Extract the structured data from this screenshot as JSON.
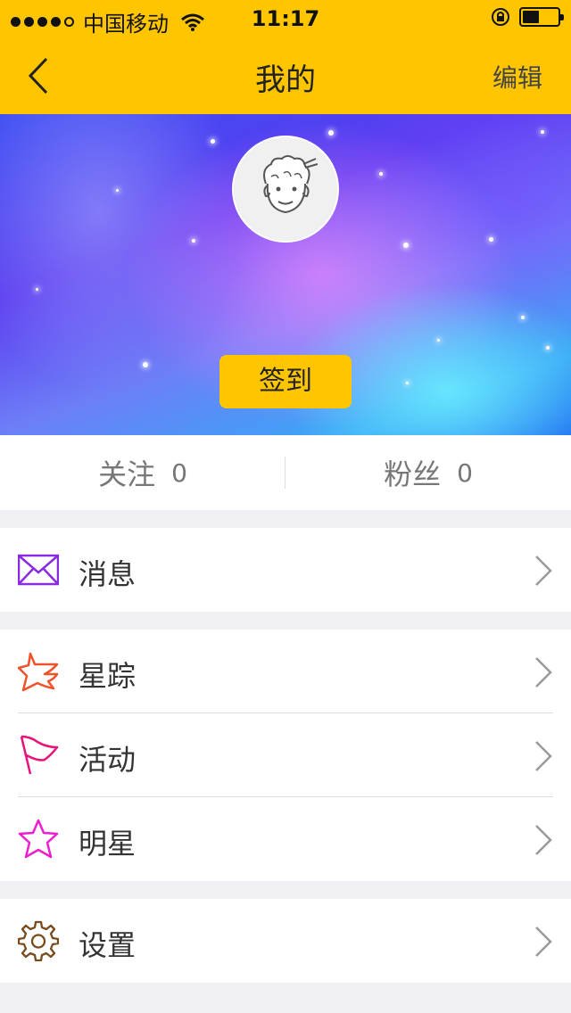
{
  "status_bar": {
    "carrier": "中国移动",
    "time": "11:17"
  },
  "nav": {
    "title": "我的",
    "edit": "编辑",
    "back_icon": "chevron-left-icon"
  },
  "hero": {
    "checkin_label": "签到",
    "avatar_icon": "cartoon-avatar-icon"
  },
  "stats": {
    "following": {
      "label": "关注",
      "count": "0"
    },
    "fans": {
      "label": "粉丝",
      "count": "0"
    }
  },
  "menu": {
    "messages": {
      "label": "消息",
      "icon": "envelope-icon",
      "color": "#8a2be2"
    },
    "star_track": {
      "label": "星踪",
      "icon": "star-wing-icon",
      "color": "#f0522a"
    },
    "activities": {
      "label": "活动",
      "icon": "flag-icon",
      "color": "#e8127c"
    },
    "stars": {
      "label": "明星",
      "icon": "star-icon",
      "color": "#ec1ecf"
    },
    "settings": {
      "label": "设置",
      "icon": "gear-icon",
      "color": "#7a4a1c"
    }
  },
  "colors": {
    "accent": "#ffc600",
    "background": "#efeff4"
  }
}
